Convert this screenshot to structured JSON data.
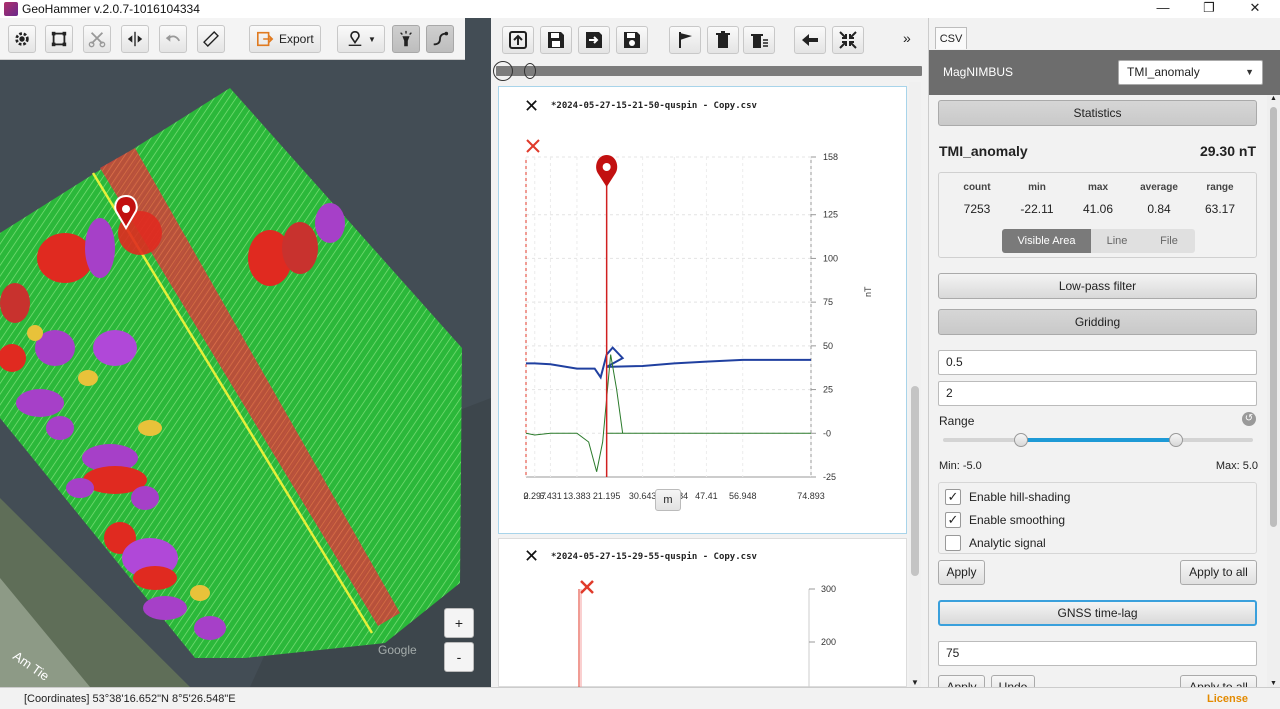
{
  "window": {
    "title": "GeoHammer v.2.0.7-1016104334",
    "minimize": "—",
    "maximize": "❐",
    "close": "✕"
  },
  "map_toolbar": {
    "export_label": "Export"
  },
  "map": {
    "zoom_in": "+",
    "zoom_out": "-",
    "street_label": "Am Tie",
    "watermark": "Google"
  },
  "mid_toolbar": {
    "collapse": "»"
  },
  "charts": [
    {
      "filename": "*2024-05-27-15-21-50-quspin - Copy.csv",
      "unit": "nT",
      "x_unit_button": "m",
      "y_ticks": [
        "158",
        "125",
        "100",
        "75",
        "50",
        "25",
        "-0",
        "-25"
      ],
      "x_ticks": [
        "0",
        "2.297",
        "6.431",
        "13.383",
        "21.195",
        "30.643",
        "38.984",
        "47.41",
        "56.948",
        "74.893"
      ],
      "chart_data": {
        "type": "line",
        "ylim": [
          -25,
          158
        ],
        "x": [
          0,
          2.297,
          6.431,
          13.383,
          21.195,
          30.643,
          38.984,
          47.41,
          56.948,
          74.893
        ],
        "series": [
          {
            "values": [
              40,
              40,
              39.5,
              37,
              38,
              38.5,
              40,
              41,
              42,
              42
            ]
          },
          {
            "values": [
              0,
              -1,
              0,
              0,
              0,
              0,
              0,
              0,
              0,
              0
            ]
          }
        ],
        "marker_x": 21.195
      }
    },
    {
      "filename": "*2024-05-27-15-29-55-quspin - Copy.csv",
      "y_ticks": [
        "300",
        "200"
      ]
    }
  ],
  "right_panel": {
    "tab": "CSV",
    "source_label": "MagNIMBUS",
    "channel_selected": "TMI_anomaly",
    "statistics_btn": "Statistics",
    "stat_name": "TMI_anomaly",
    "stat_value": "29.30 nT",
    "stats": {
      "headers": [
        "count",
        "min",
        "max",
        "average",
        "range"
      ],
      "values": [
        "7253",
        "-22.11",
        "41.06",
        "0.84",
        "63.17"
      ]
    },
    "scope_tabs": [
      "Visible Area",
      "Line",
      "File"
    ],
    "lowpass_btn": "Low-pass filter",
    "gridding_btn": "Gridding",
    "cell_size": "0.5",
    "blanking": "2",
    "range_label": "Range",
    "range_min": "Min: -5.0",
    "range_max": "Max: 5.0",
    "range_values": {
      "min": -5.0,
      "max": 5.0
    },
    "options": [
      {
        "label": "Enable hill-shading",
        "checked": true
      },
      {
        "label": "Enable smoothing",
        "checked": true
      },
      {
        "label": "Analytic signal",
        "checked": false
      }
    ],
    "apply": "Apply",
    "apply_all": "Apply to all",
    "gnss_btn": "GNSS time-lag",
    "timelag_value": "75",
    "apply2": "Apply",
    "undo": "Undo",
    "apply_all2": "Apply to all"
  },
  "status": {
    "coordinates": "[Coordinates] 53°38'16.652\"N  8°5'26.548\"E",
    "license": "License"
  }
}
